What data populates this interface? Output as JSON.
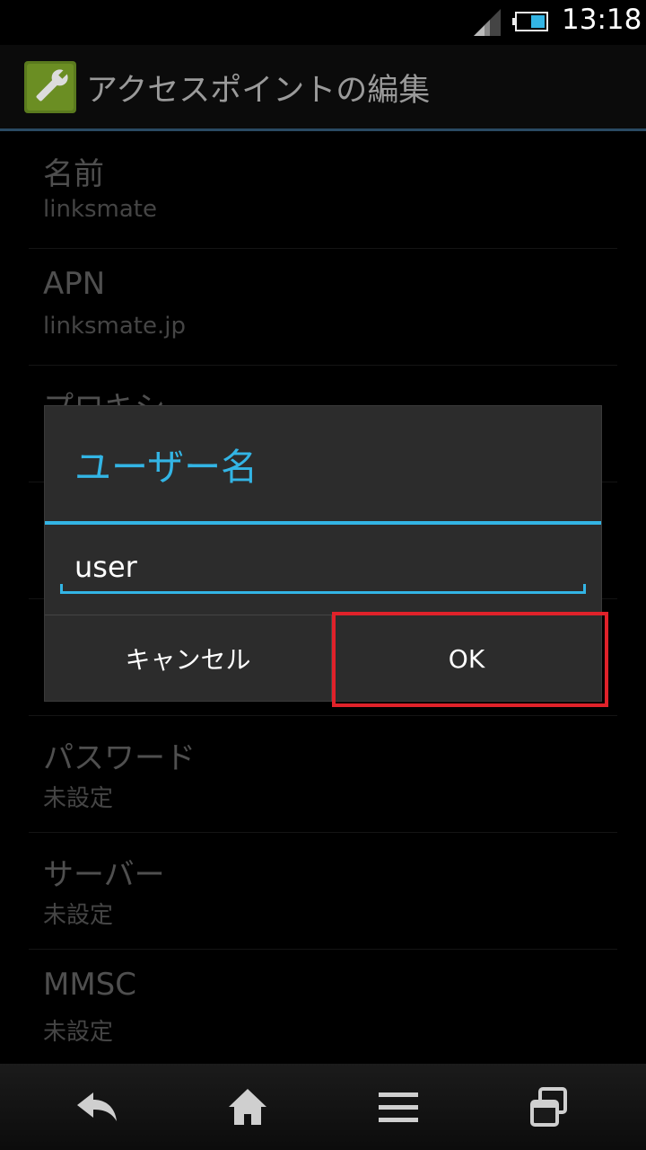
{
  "status_bar": {
    "time": "13:18",
    "icons": [
      "signal-icon",
      "battery-icon"
    ]
  },
  "action_bar": {
    "title": "アクセスポイントの編集",
    "icon": "wrench-icon"
  },
  "settings": [
    {
      "title": "名前",
      "summary": "linksmate"
    },
    {
      "title": "APN",
      "summary": "linksmate.jp"
    },
    {
      "title": "プロキシ",
      "summary": ""
    },
    {
      "title": "",
      "summary": ""
    },
    {
      "title": "",
      "summary": ""
    },
    {
      "title": "パスワード",
      "summary": "未設定"
    },
    {
      "title": "サーバー",
      "summary": "未設定"
    },
    {
      "title": "MMSC",
      "summary": "未設定"
    }
  ],
  "dialog": {
    "title": "ユーザー名",
    "input_value": "user",
    "cancel_label": "キャンセル",
    "ok_label": "OK"
  },
  "nav_bar": {
    "icons": [
      "back-icon",
      "home-icon",
      "menu-icon",
      "recent-apps-icon"
    ]
  },
  "colors": {
    "accent": "#33b5e5",
    "highlight": "#e0222a"
  }
}
